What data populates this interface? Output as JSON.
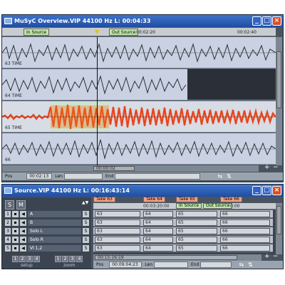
{
  "overview_window": {
    "title": "MuSyC Overview.VIP   44100 Hz L: 00:04:33",
    "ruler": {
      "in_source": "In Source",
      "out_source": "Out Source",
      "time_a": "00:02:20",
      "time_b": "00:02:40"
    },
    "tracks": [
      {
        "label": "63  TIME"
      },
      {
        "label": "64  TIME"
      },
      {
        "label": "65  TIME"
      },
      {
        "label": "66"
      }
    ],
    "scroll_readout": "00:00:02",
    "status": {
      "pos_label": "Pos",
      "pos_value": "00:02:13",
      "len_label": "Len",
      "end_label": "End"
    },
    "colors": {
      "active_wave": "#e8431a",
      "active_wave_hi": "#f07a1c",
      "wave": "#2a2f38"
    }
  },
  "source_window": {
    "title": "Source.VIP   44100 Hz L: 00:16:43:14",
    "s_button": "S",
    "m_button": "M",
    "takes": [
      "Take 63",
      "Take 64",
      "Take 65",
      "Take 66"
    ],
    "ruler": {
      "time_a": "00:03:20:00",
      "in_source": "In Source",
      "out_source": "Out Source",
      "time_b": "0:00"
    },
    "tracks": [
      {
        "num": "1",
        "name": "A",
        "solo": "S"
      },
      {
        "num": "2",
        "name": "B",
        "solo": "S"
      },
      {
        "num": "3",
        "name": "Solo L",
        "solo": "S"
      },
      {
        "num": "4",
        "name": "Solo R",
        "solo": "S"
      },
      {
        "num": "5",
        "name": "Vl 1,2",
        "solo": "S"
      }
    ],
    "lane_clip_labels": [
      "63",
      "64",
      "65",
      "66"
    ],
    "setup_numbers": [
      "1",
      "2",
      "3",
      "4"
    ],
    "zoom_numbers": [
      "1",
      "2",
      "3",
      "4"
    ],
    "setup_label": "setup",
    "zoom_label": "zoom",
    "scroll_readout": "00:15:16:19",
    "status": {
      "pos_label": "Pos",
      "pos_value": "00:09:04:23",
      "len_label": "Len",
      "end_label": "End"
    }
  }
}
